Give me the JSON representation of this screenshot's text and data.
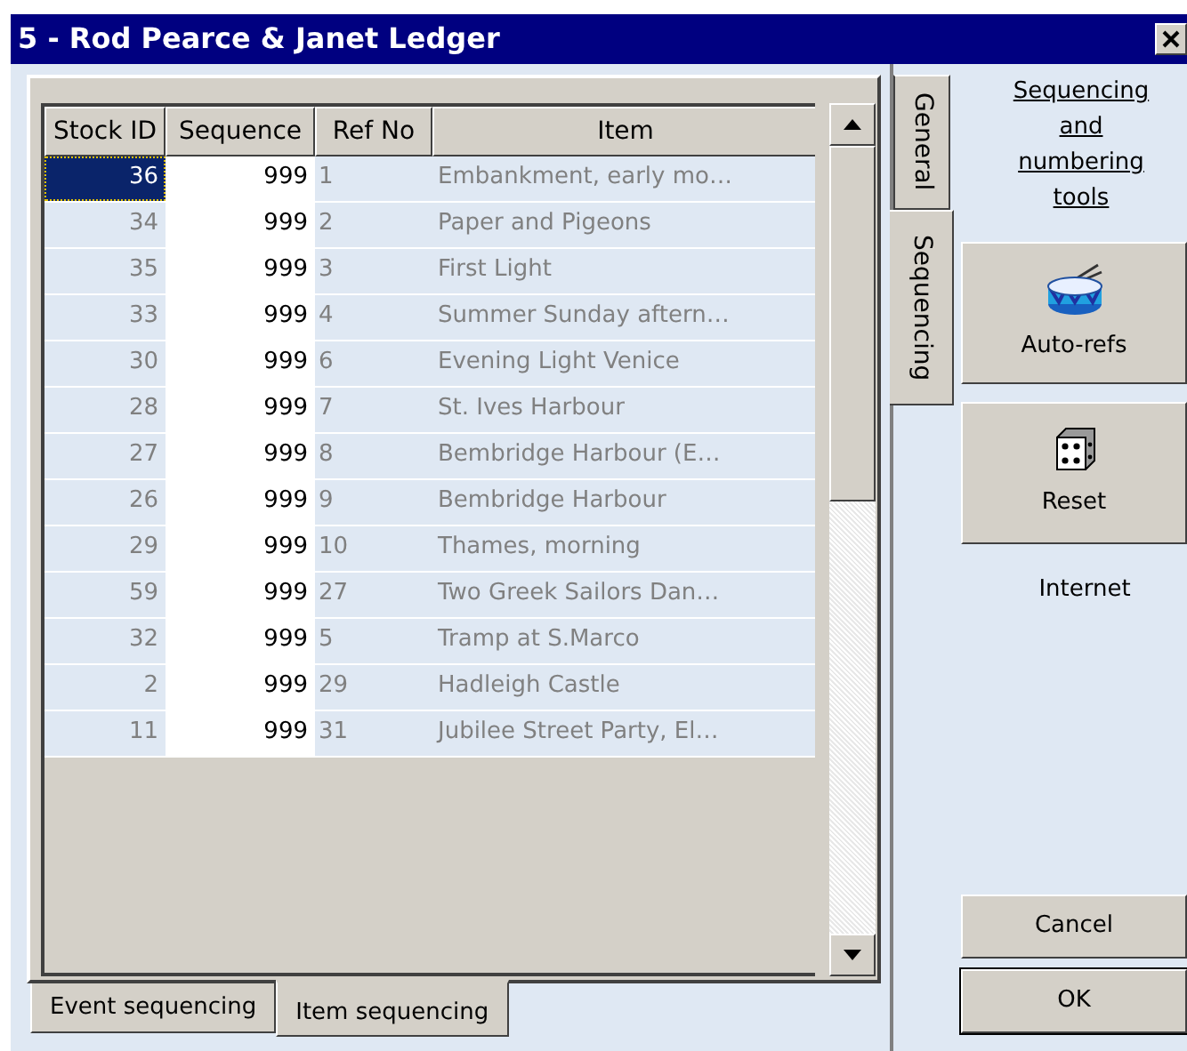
{
  "window": {
    "title": "5 - Rod Pearce & Janet Ledger"
  },
  "table": {
    "columns": [
      "Stock ID",
      "Sequence",
      "Ref No",
      "Item"
    ],
    "rows": [
      {
        "stock_id": "36",
        "sequence": "999",
        "ref_no": "1",
        "item": "Embankment, early mo…",
        "selected": true
      },
      {
        "stock_id": "34",
        "sequence": "999",
        "ref_no": "2",
        "item": "Paper and Pigeons",
        "selected": false
      },
      {
        "stock_id": "35",
        "sequence": "999",
        "ref_no": "3",
        "item": "First Light",
        "selected": false
      },
      {
        "stock_id": "33",
        "sequence": "999",
        "ref_no": "4",
        "item": "Summer Sunday aftern…",
        "selected": false
      },
      {
        "stock_id": "30",
        "sequence": "999",
        "ref_no": "6",
        "item": "Evening Light Venice",
        "selected": false
      },
      {
        "stock_id": "28",
        "sequence": "999",
        "ref_no": "7",
        "item": "St. Ives Harbour",
        "selected": false
      },
      {
        "stock_id": "27",
        "sequence": "999",
        "ref_no": "8",
        "item": "Bembridge Harbour (E…",
        "selected": false
      },
      {
        "stock_id": "26",
        "sequence": "999",
        "ref_no": "9",
        "item": "Bembridge Harbour",
        "selected": false
      },
      {
        "stock_id": "29",
        "sequence": "999",
        "ref_no": "10",
        "item": "Thames, morning",
        "selected": false
      },
      {
        "stock_id": "59",
        "sequence": "999",
        "ref_no": "27",
        "item": "Two Greek Sailors Dan…",
        "selected": false
      },
      {
        "stock_id": "32",
        "sequence": "999",
        "ref_no": "5",
        "item": "Tramp at S.Marco",
        "selected": false
      },
      {
        "stock_id": "2",
        "sequence": "999",
        "ref_no": "29",
        "item": "Hadleigh Castle",
        "selected": false
      },
      {
        "stock_id": "11",
        "sequence": "999",
        "ref_no": "31",
        "item": "Jubilee Street Party, El…",
        "selected": false
      }
    ]
  },
  "bottom_tabs": [
    {
      "label": "Event sequencing",
      "selected": false
    },
    {
      "label": "Item sequencing",
      "selected": true
    }
  ],
  "side_tabs": [
    {
      "label": "General",
      "selected": false
    },
    {
      "label": "Sequencing",
      "selected": true
    }
  ],
  "tools_link": "Sequencing and numbering tools",
  "tool_buttons": [
    {
      "kind": "drum",
      "label": "Auto-refs"
    },
    {
      "kind": "die",
      "label": "Reset"
    }
  ],
  "internet_label": "Internet",
  "buttons": [
    "Cancel",
    "OK"
  ]
}
